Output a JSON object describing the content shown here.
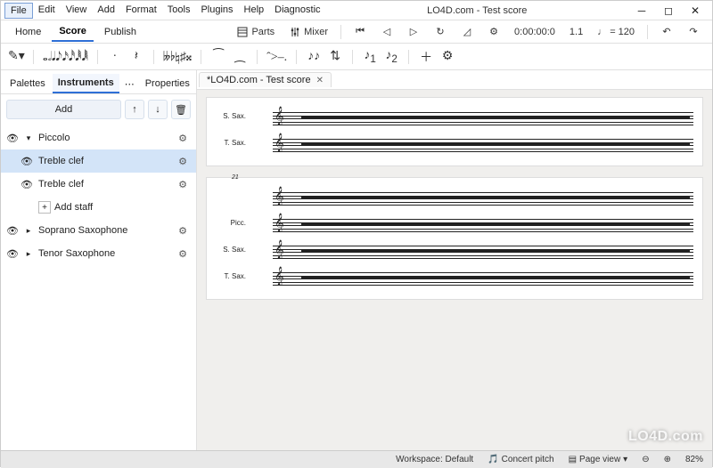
{
  "window": {
    "title": "LO4D.com - Test score",
    "menus": [
      "File",
      "Edit",
      "View",
      "Add",
      "Format",
      "Tools",
      "Plugins",
      "Help",
      "Diagnostic"
    ],
    "selected_menu": 0
  },
  "main_tabs": {
    "items": [
      "Home",
      "Score",
      "Publish"
    ],
    "active": 1
  },
  "top_toolbar": {
    "parts_label": "Parts",
    "mixer_label": "Mixer",
    "time_readout": "0:00:00:0",
    "position_readout": "1.1",
    "tempo_note": "♩",
    "tempo_eq": "=",
    "tempo_value": "120"
  },
  "note_toolbar": {
    "durations": [
      "𝅝",
      "𝅗𝅥",
      "𝅘𝅥",
      "𝅘𝅥𝅮",
      "𝅘𝅥𝅯",
      "𝅘𝅥𝅰",
      "𝅘𝅥𝅱",
      "𝅘𝅥𝅲"
    ],
    "dot": "·",
    "rest": "𝄽",
    "accidentals": [
      "𝄫",
      "♭",
      "♮",
      "♯",
      "𝄪"
    ],
    "tie": "⁀",
    "slur": "⁔",
    "articulations": [
      "ˆ",
      ">",
      "–",
      "."
    ],
    "voice1": "1",
    "voice2": "2"
  },
  "sidebar": {
    "tabs": [
      "Palettes",
      "Instruments",
      "Properties"
    ],
    "active": 1,
    "add_label": "Add",
    "items": [
      {
        "label": "Piccolo",
        "expanded": true,
        "selected": false
      },
      {
        "label": "Treble clef",
        "indent": 1,
        "selected": true
      },
      {
        "label": "Treble clef",
        "indent": 1,
        "selected": false
      },
      {
        "label": "Add staff",
        "indent": 2,
        "addstaff": true
      },
      {
        "label": "Soprano Saxophone",
        "expanded": false
      },
      {
        "label": "Tenor Saxophone",
        "expanded": false
      }
    ]
  },
  "doc_tab": {
    "label": "*LO4D.com - Test score"
  },
  "score": {
    "systems": [
      {
        "staves": [
          {
            "label": "S. Sax."
          },
          {
            "label": "T. Sax."
          }
        ],
        "measure_start": null
      },
      {
        "staves": [
          {
            "label": ""
          },
          {
            "label": "Picc."
          },
          {
            "label": "S. Sax."
          },
          {
            "label": "T. Sax."
          }
        ],
        "measure_start": "21"
      }
    ],
    "measures_per_line": 10
  },
  "statusbar": {
    "workspace": "Workspace: Default",
    "concert_pitch": "Concert pitch",
    "page_view": "Page view",
    "zoom": "82%"
  },
  "watermark": "LO4D.com"
}
